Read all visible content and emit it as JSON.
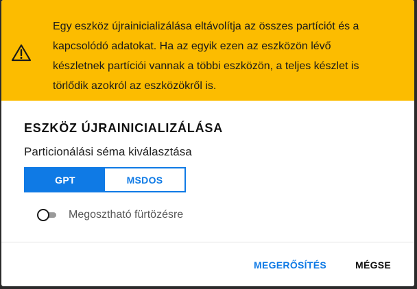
{
  "warning": {
    "icon": "warning-icon",
    "lines": [
      "Egy eszköz újrainicializálása eltávolítja az összes partíciót és a",
      "kapcsolódó adatokat. Ha az egyik ezen az eszközön lévő",
      "készletnek partíciói vannak a többi eszközön, a teljes készlet is",
      "törlődik azokról az eszközökről is."
    ],
    "background": "#fcbc00"
  },
  "dialog": {
    "title": "ESZKÖZ ÚJRAINICIALIZÁLÁSA",
    "subtitle": "Particionálási séma kiválasztása"
  },
  "scheme": {
    "options": [
      "GPT",
      "MSDOS"
    ],
    "selected": "GPT",
    "accent": "#0f7ae5"
  },
  "cluster_toggle": {
    "label": "Megosztható fürtözésre",
    "enabled": false
  },
  "actions": {
    "confirm_label": "MEGERŐSÍTÉS",
    "cancel_label": "MÉGSE"
  }
}
